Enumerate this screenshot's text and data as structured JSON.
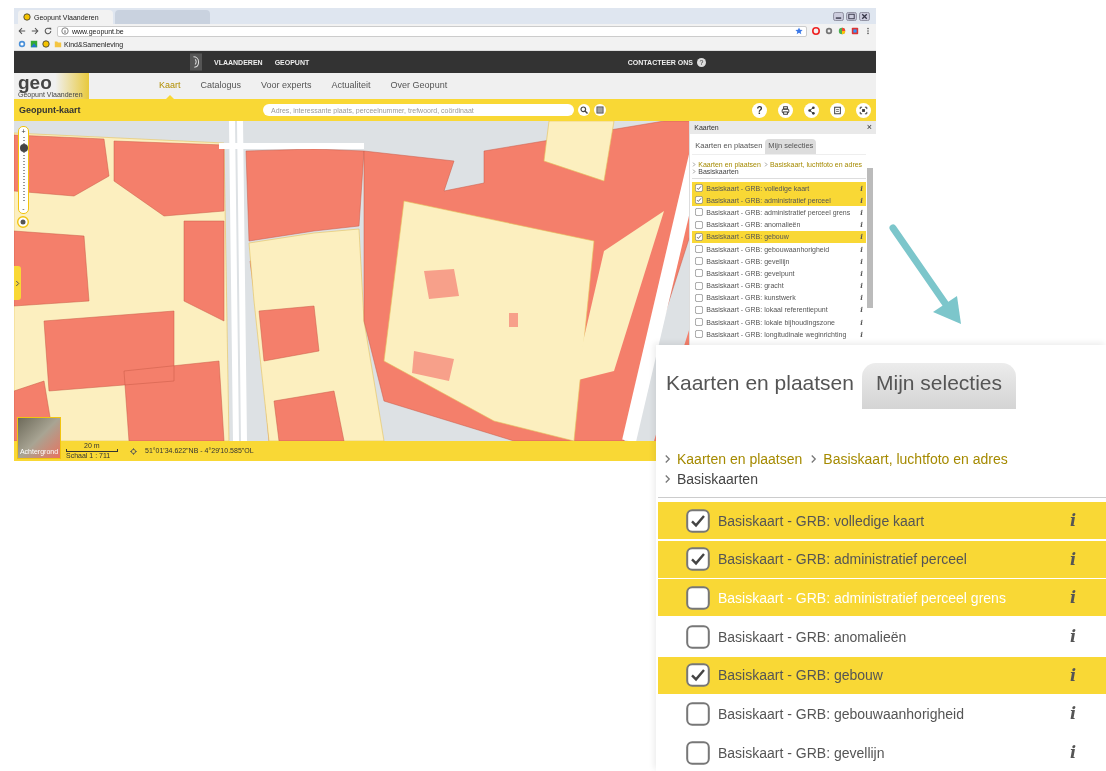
{
  "browser": {
    "tabs": [
      {
        "title": "Geopunt Vlaanderen",
        "selected": true
      },
      {
        "selected": false
      }
    ],
    "url": "www.geopunt.be",
    "bookmarks": [
      {
        "label": "Kind&Samenleving"
      }
    ]
  },
  "top_bar": {
    "links": [
      "VLAANDEREN",
      "GEOPUNT"
    ],
    "contact": "CONTACTEER ONS",
    "contact_icon": "?"
  },
  "logo": {
    "text": "geo",
    "subtitle": "Geopunt Vlaanderen"
  },
  "nav": [
    {
      "label": "Kaart",
      "selected": true
    },
    {
      "label": "Catalogus",
      "selected": false
    },
    {
      "label": "Voor experts",
      "selected": false
    },
    {
      "label": "Actualiteit",
      "selected": false
    },
    {
      "label": "Over Geopunt",
      "selected": false
    }
  ],
  "toolbar": {
    "title": "Geopunt-kaart",
    "search": {
      "placeholder": "Adres, interessante plaats, perceelnummer, trefwoord, coördinaat"
    },
    "help": "?"
  },
  "map": {
    "zoom_in": "+",
    "zoom_out": "-",
    "zoom": {
      "level": 0.83
    }
  },
  "panel": {
    "title": "Kaarten",
    "close": "×",
    "tabs": [
      {
        "label": "Kaarten en plaatsen",
        "selected": true
      },
      {
        "label": "Mijn selecties",
        "selected": false
      }
    ],
    "breadcrumb": [
      {
        "label": "Kaarten en plaatsen",
        "link": true
      },
      {
        "label": "Basiskaart, luchtfoto en adres",
        "link": true
      },
      {
        "label": "Basiskaarten",
        "link": false
      }
    ],
    "layers": [
      {
        "label": "Basiskaart - GRB: volledige kaart",
        "checked": true,
        "highlighted": true,
        "info": "i"
      },
      {
        "label": "Basiskaart - GRB: administratief perceel",
        "checked": true,
        "highlighted": true,
        "info": "i"
      },
      {
        "label": "Basiskaart - GRB: administratief perceel grens",
        "checked": false,
        "highlighted": false,
        "info": "i"
      },
      {
        "label": "Basiskaart - GRB: anomalieën",
        "checked": false,
        "highlighted": false,
        "info": "i"
      },
      {
        "label": "Basiskaart - GRB: gebouw",
        "checked": true,
        "highlighted": true,
        "info": "i"
      },
      {
        "label": "Basiskaart - GRB: gebouwaanhorigheid",
        "checked": false,
        "highlighted": false,
        "info": "i"
      },
      {
        "label": "Basiskaart - GRB: gevellijn",
        "checked": false,
        "highlighted": false,
        "info": "i"
      },
      {
        "label": "Basiskaart - GRB: gevelpunt",
        "checked": false,
        "highlighted": false,
        "info": "i"
      },
      {
        "label": "Basiskaart - GRB: gracht",
        "checked": false,
        "highlighted": false,
        "info": "i"
      },
      {
        "label": "Basiskaart - GRB: kunstwerk",
        "checked": false,
        "highlighted": false,
        "info": "i"
      },
      {
        "label": "Basiskaart - GRB: lokaal referentiepunt",
        "checked": false,
        "highlighted": false,
        "info": "i"
      },
      {
        "label": "Basiskaart - GRB: lokale bijhoudingszone",
        "checked": false,
        "highlighted": false,
        "info": "i"
      },
      {
        "label": "Basiskaart - GRB: longitudinale weginrichting",
        "checked": false,
        "highlighted": false,
        "info": "i"
      }
    ]
  },
  "status_bar": {
    "background_label": "Achtergrond",
    "scale_bar": "20 m",
    "scale": "Schaal 1 : 711",
    "coordinates": "51°01'34.622\"NB - 4°29'10.585\"OL"
  },
  "inset": {
    "tabs": [
      {
        "label": "Kaarten en plaatsen",
        "selected": true
      },
      {
        "label": "Mijn selecties",
        "selected": false
      }
    ],
    "breadcrumb": [
      {
        "label": "Kaarten en plaatsen",
        "link": true
      },
      {
        "label": "Basiskaart, luchtfoto en adres",
        "link": true
      },
      {
        "label": "Basiskaarten",
        "link": false
      }
    ],
    "layers": [
      {
        "label": "Basiskaart - GRB: volledige kaart",
        "checked": true,
        "highlighted": true,
        "info": "i"
      },
      {
        "label": "Basiskaart - GRB: administratief perceel",
        "checked": true,
        "highlighted": true,
        "info": "i"
      },
      {
        "label": "Basiskaart - GRB: administratief perceel grens",
        "checked": false,
        "highlighted": true,
        "info": "i"
      },
      {
        "label": "Basiskaart - GRB: anomalieën",
        "checked": false,
        "highlighted": false,
        "info": "i"
      },
      {
        "label": "Basiskaart - GRB: gebouw",
        "checked": true,
        "highlighted": true,
        "info": "i"
      },
      {
        "label": "Basiskaart - GRB: gebouwaanhorigheid",
        "checked": false,
        "highlighted": false,
        "info": "i"
      },
      {
        "label": "Basiskaart - GRB: gevellijn",
        "checked": false,
        "highlighted": false,
        "info": "i"
      }
    ]
  }
}
